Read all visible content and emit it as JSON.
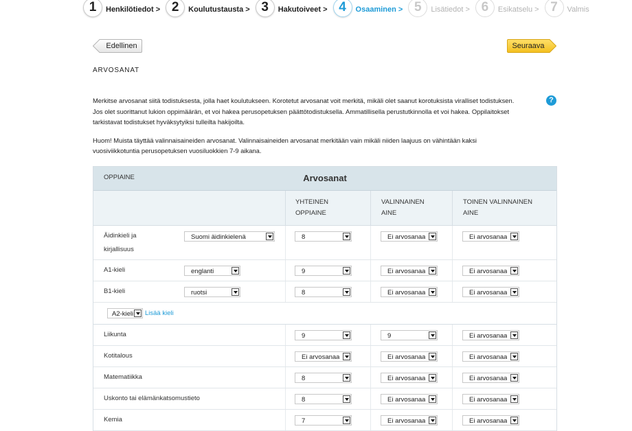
{
  "steps": [
    {
      "number": "1",
      "label": "Henkilötiedot >"
    },
    {
      "number": "2",
      "label": "Koulutustausta >"
    },
    {
      "number": "3",
      "label": "Hakutoiveet >"
    },
    {
      "number": "4",
      "label": "Osaaminen >"
    },
    {
      "number": "5",
      "label": "Lisätiedot >"
    },
    {
      "number": "6",
      "label": "Esikatselu >"
    },
    {
      "number": "7",
      "label": "Valmis"
    }
  ],
  "nav": {
    "prev_label": "Edellinen",
    "next_label": "Seuraava"
  },
  "section_title": "ARVOSANAT",
  "help_symbol": "?",
  "intro": {
    "paragraph1": "Merkitse arvosanat siitä todistuksesta, jolla haet koulutukseen. Korotetut arvosanat voit merkitä, mikäli olet saanut korotuksista viralliset todistuksen. Jos olet suorittanut lukion oppimäärän, et voi hakea perusopetuksen päättötodistuksella. Ammatillisella perustutkinnolla et voi hakea. Oppilaitokset tarkistavat todistukset hyväksytyiksi tulleilta hakijoilta.",
    "paragraph2": "Huom! Muista täyttää valinnaisaineiden arvosanat. Valinnaisaineiden arvosanat merkitään vain mikäli niiden laajuus on vähintään kaksi vuosiviikkotuntia perusopetuksen vuosiluokkien 7-9 aikana."
  },
  "table": {
    "title": "Arvosanat",
    "headers": {
      "subject": "OPPIAINE",
      "common_1": "YHTEINEN",
      "common_2": "OPPIAINE",
      "elective_1": "VALINNAINEN",
      "elective_2": "AINE",
      "elective2_1": "TOINEN VALINNAINEN",
      "elective2_2": "AINE"
    },
    "rows": [
      {
        "subject_1": "Äidinkieli ja",
        "subject_2": "kirjallisuus",
        "language": "Suomi äidinkielenä",
        "common": "8",
        "elective": "Ei arvosanaa",
        "elective2": "Ei arvosanaa"
      },
      {
        "subject_1": "A1-kieli",
        "language": "englanti",
        "common": "9",
        "elective": "Ei arvosanaa",
        "elective2": "Ei arvosanaa"
      },
      {
        "subject_1": "B1-kieli",
        "language": "ruotsi",
        "common": "8",
        "elective": "Ei arvosanaa",
        "elective2": "Ei arvosanaa"
      }
    ],
    "add_language": {
      "select_value": "A2-kieli",
      "link": "Lisää kieli"
    },
    "simple_rows": [
      {
        "subject": "Liikunta",
        "common": "9",
        "elective": "9",
        "elective2": "Ei arvosanaa"
      },
      {
        "subject": "Kotitalous",
        "common": "Ei arvosanaa",
        "elective": "Ei arvosanaa",
        "elective2": "Ei arvosanaa"
      },
      {
        "subject": "Matematiikka",
        "common": "8",
        "elective": "Ei arvosanaa",
        "elective2": "Ei arvosanaa"
      },
      {
        "subject": "Uskonto tai elämänkatsomustieto",
        "common": "8",
        "elective": "Ei arvosanaa",
        "elective2": "Ei arvosanaa"
      },
      {
        "subject": "Kemia",
        "common": "7",
        "elective": "Ei arvosanaa",
        "elective2": "Ei arvosanaa"
      }
    ]
  }
}
